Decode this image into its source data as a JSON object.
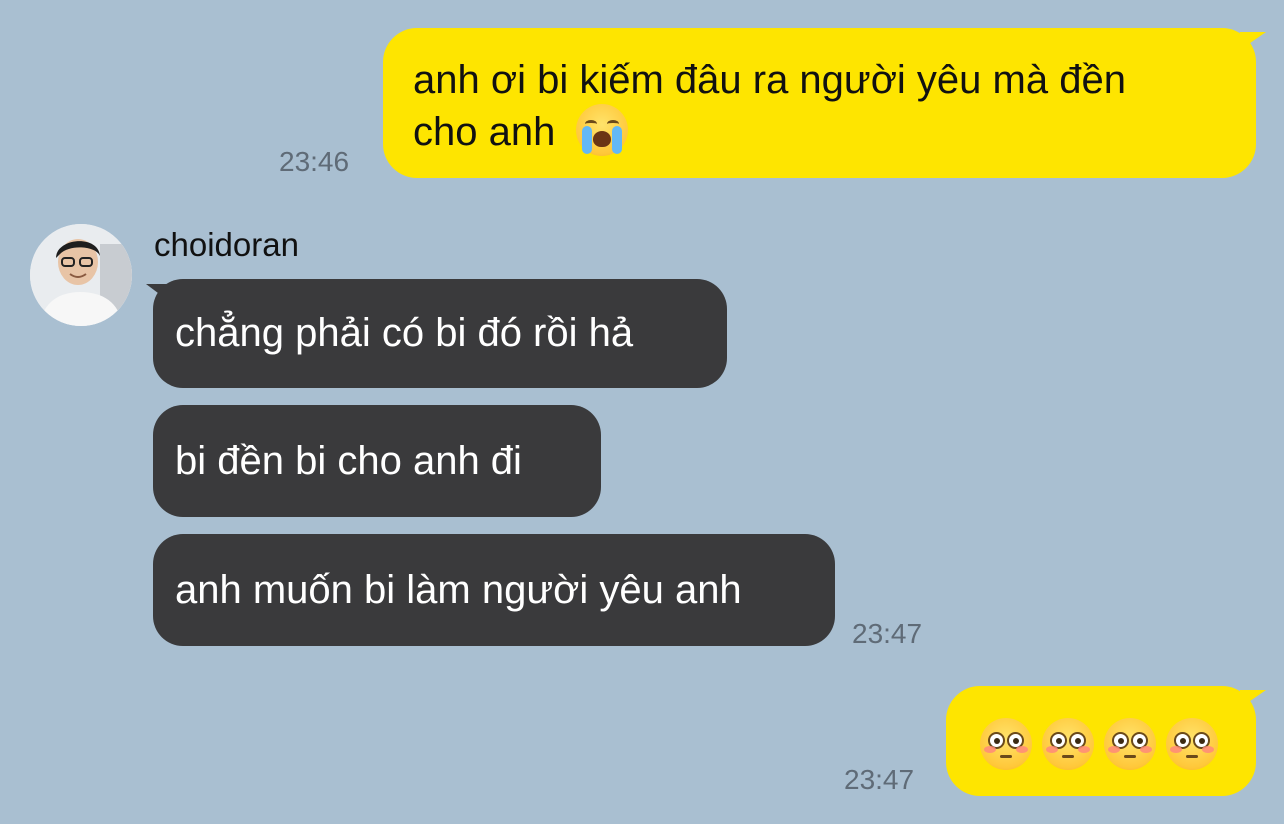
{
  "conversation": {
    "messages": [
      {
        "direction": "outgoing",
        "text": "anh ơi bi kiếm đâu ra người yêu mà đền",
        "text_line2": "cho anh",
        "emoji": "loudly-crying-face-icon",
        "time": "23:46"
      },
      {
        "direction": "incoming",
        "text": "chẳng phải có bi đó rồi hả"
      },
      {
        "direction": "incoming",
        "text": "bi đền bi cho anh đi"
      },
      {
        "direction": "incoming",
        "text": "anh muốn bi làm người yêu anh",
        "time": "23:47"
      },
      {
        "direction": "outgoing",
        "emoji": "flushed-face-icon",
        "emoji_count": 4,
        "time": "23:47"
      }
    ],
    "sender": {
      "name": "choidoran",
      "avatar": "avatar-photo"
    }
  },
  "colors": {
    "background": "#a9bfd1",
    "outgoing_bubble": "#fee500",
    "incoming_bubble": "#3a3a3c",
    "timestamp": "#5f6b77"
  }
}
